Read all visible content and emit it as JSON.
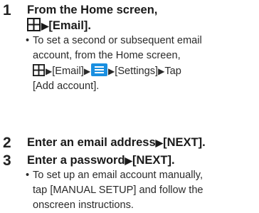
{
  "steps": [
    {
      "number": "1",
      "heading_line1": "From the Home screen,",
      "heading_line2_after_icon": "[Email].",
      "note_lines": {
        "l1": "To set a second or subsequent email",
        "l2": "account, from the Home screen,",
        "l3_a": "[Email]",
        "l3_b": "[Settings]",
        "l3_c": "Tap",
        "l4": "[Add account]."
      }
    },
    {
      "number": "2",
      "heading_a": "Enter an email address",
      "heading_b": "[NEXT]."
    },
    {
      "number": "3",
      "heading_a": "Enter a password",
      "heading_b": "[NEXT].",
      "note_lines": {
        "l1": "To set up an email account manually,",
        "l2": "tap [MANUAL SETUP] and follow the",
        "l3": "onscreen instructions."
      }
    }
  ],
  "glyphs": {
    "arrow": "▶",
    "bullet": "•"
  },
  "icons": [
    "apps-grid-icon",
    "menu-icon"
  ],
  "colors": {
    "menu_icon_bg": "#1a8fe0",
    "text": "#1a1a1a"
  }
}
